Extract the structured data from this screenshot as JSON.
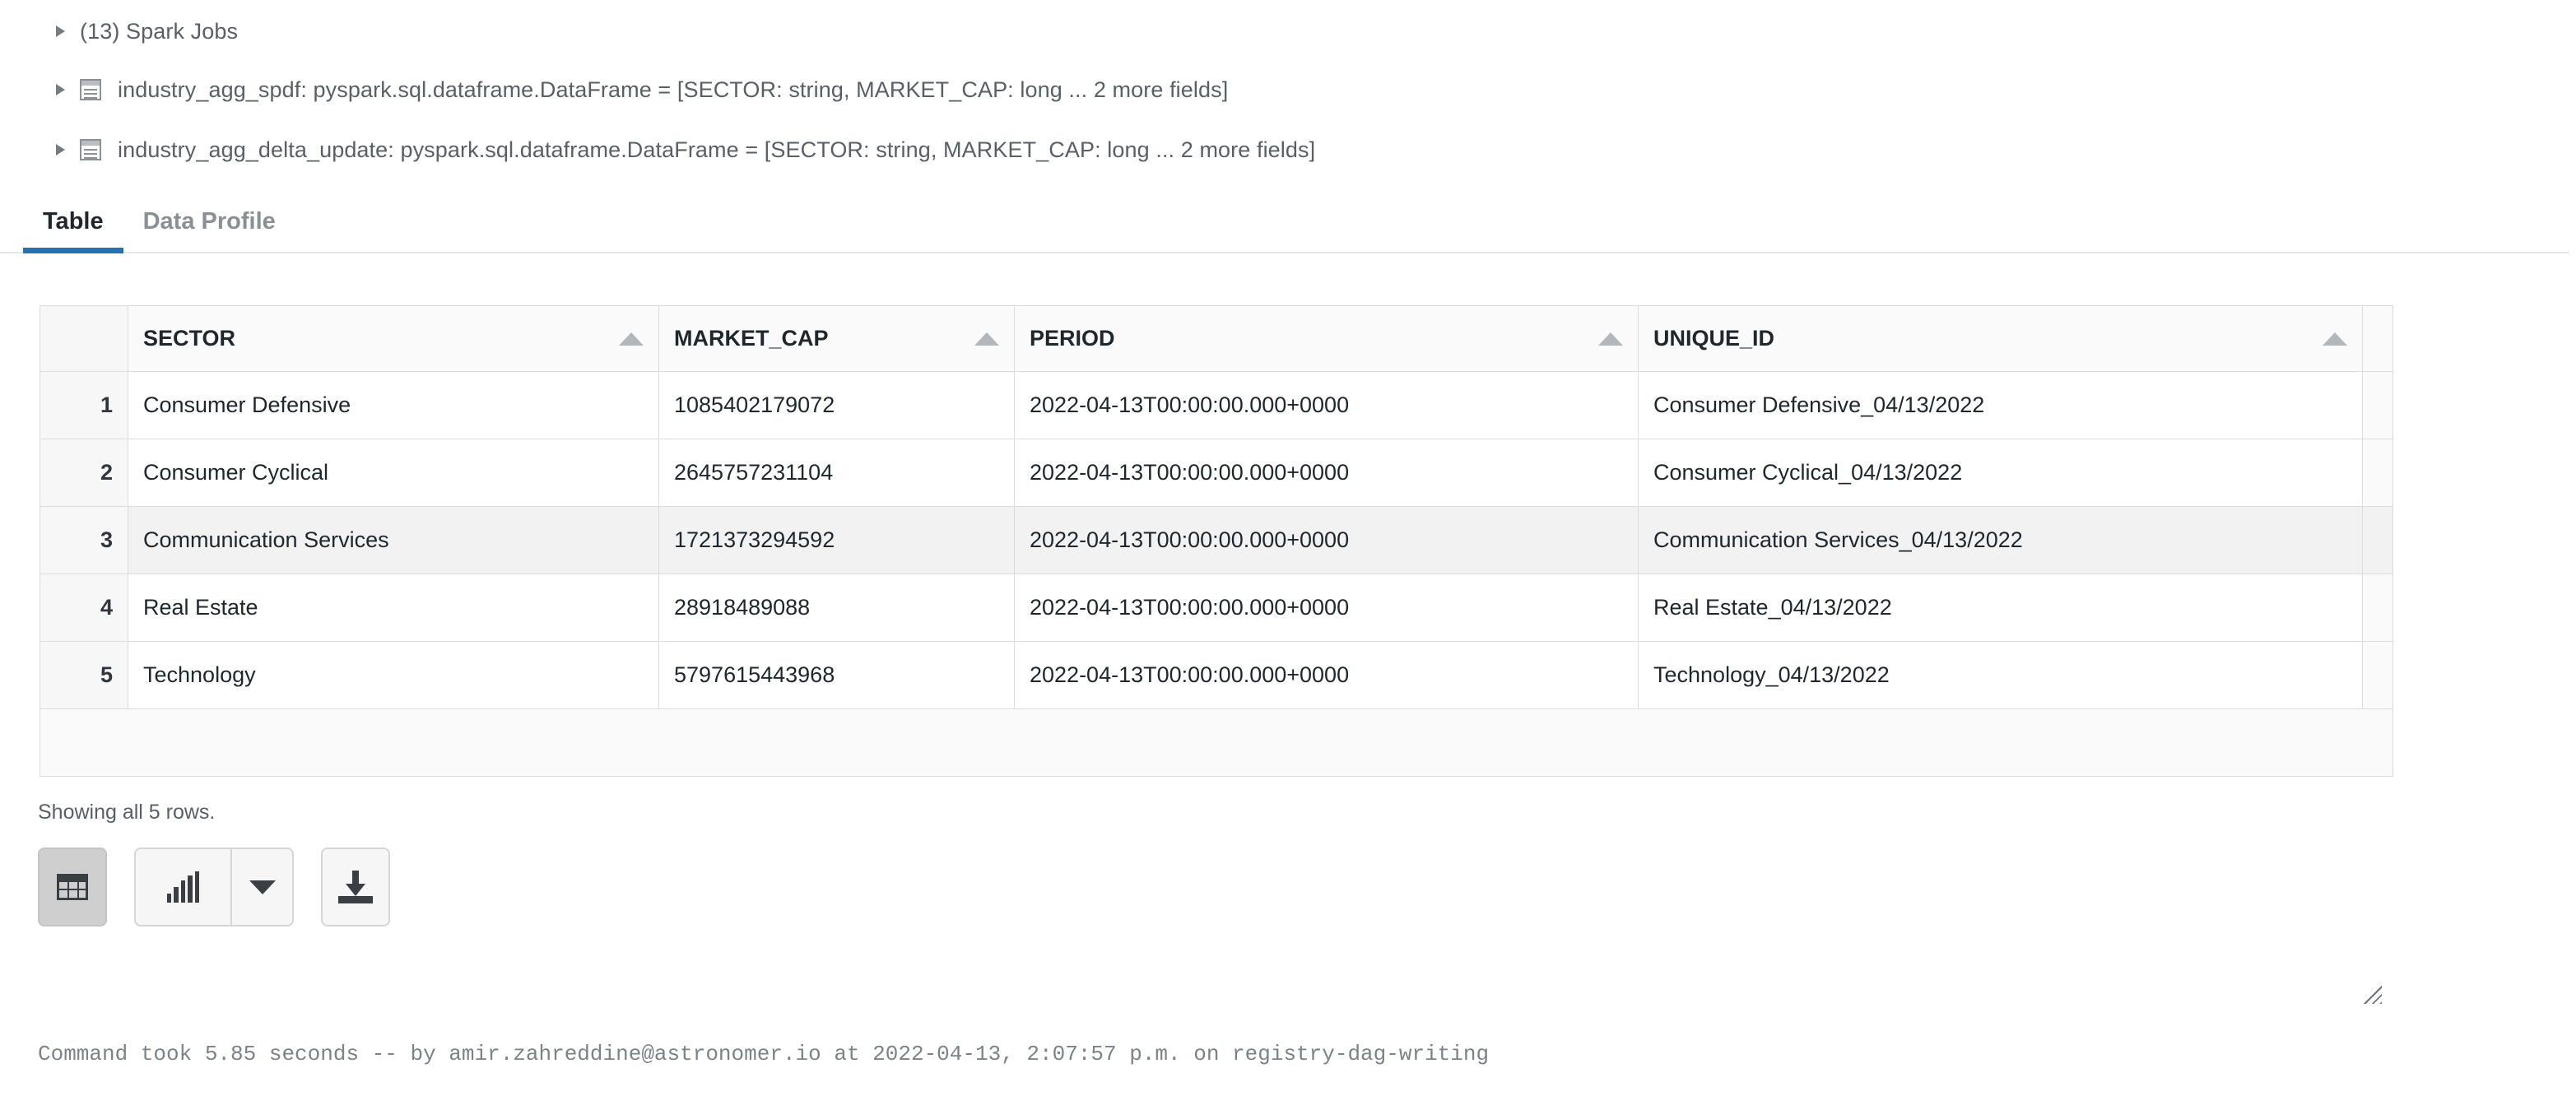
{
  "results": {
    "spark_jobs": {
      "label": "(13) Spark Jobs",
      "twisty": "collapsed"
    },
    "dataframes": [
      {
        "icon": "dataframe-icon",
        "text": "industry_agg_spdf:  pyspark.sql.dataframe.DataFrame = [SECTOR: string, MARKET_CAP: long ... 2 more fields]"
      },
      {
        "icon": "dataframe-icon",
        "text": "industry_agg_delta_update:  pyspark.sql.dataframe.DataFrame = [SECTOR: string, MARKET_CAP: long ... 2 more fields]"
      }
    ]
  },
  "tabs": {
    "active": "Table",
    "items": [
      {
        "label": "Table"
      },
      {
        "label": "Data Profile"
      }
    ],
    "accent_color": "#2272b4"
  },
  "table": {
    "columns": [
      "SECTOR",
      "MARKET_CAP",
      "PERIOD",
      "UNIQUE_ID"
    ],
    "sort_icon": "sort-ascending-caret",
    "rows": [
      {
        "num": "1",
        "SECTOR": "Consumer Defensive",
        "MARKET_CAP": "1085402179072",
        "PERIOD": "2022-04-13T00:00:00.000+0000",
        "UNIQUE_ID": "Consumer Defensive_04/13/2022",
        "highlight": false
      },
      {
        "num": "2",
        "SECTOR": "Consumer Cyclical",
        "MARKET_CAP": "2645757231104",
        "PERIOD": "2022-04-13T00:00:00.000+0000",
        "UNIQUE_ID": "Consumer Cyclical_04/13/2022",
        "highlight": false
      },
      {
        "num": "3",
        "SECTOR": "Communication Services",
        "MARKET_CAP": "1721373294592",
        "PERIOD": "2022-04-13T00:00:00.000+0000",
        "UNIQUE_ID": "Communication Services_04/13/2022",
        "highlight": true
      },
      {
        "num": "4",
        "SECTOR": "Real Estate",
        "MARKET_CAP": "28918489088",
        "PERIOD": "2022-04-13T00:00:00.000+0000",
        "UNIQUE_ID": "Real Estate_04/13/2022",
        "highlight": false
      },
      {
        "num": "5",
        "SECTOR": "Technology",
        "MARKET_CAP": "5797615443968",
        "PERIOD": "2022-04-13T00:00:00.000+0000",
        "UNIQUE_ID": "Technology_04/13/2022",
        "highlight": false
      }
    ]
  },
  "footer": {
    "showing": "Showing all 5 rows.",
    "buttons": [
      {
        "name": "table-view-button",
        "icon": "table-grid-icon",
        "pressed": true
      },
      {
        "name": "chart-view-button",
        "icon": "bar-chart-icon",
        "pressed": false
      },
      {
        "name": "chart-options-button",
        "icon": "chevron-down-icon",
        "pressed": false
      },
      {
        "name": "download-button",
        "icon": "download-icon",
        "pressed": false
      }
    ],
    "resize_handle": "resize-grip",
    "command_status": "Command took 5.85 seconds -- by amir.zahreddine@astronomer.io at 2022-04-13, 2:07:57 p.m. on registry-dag-writing"
  }
}
